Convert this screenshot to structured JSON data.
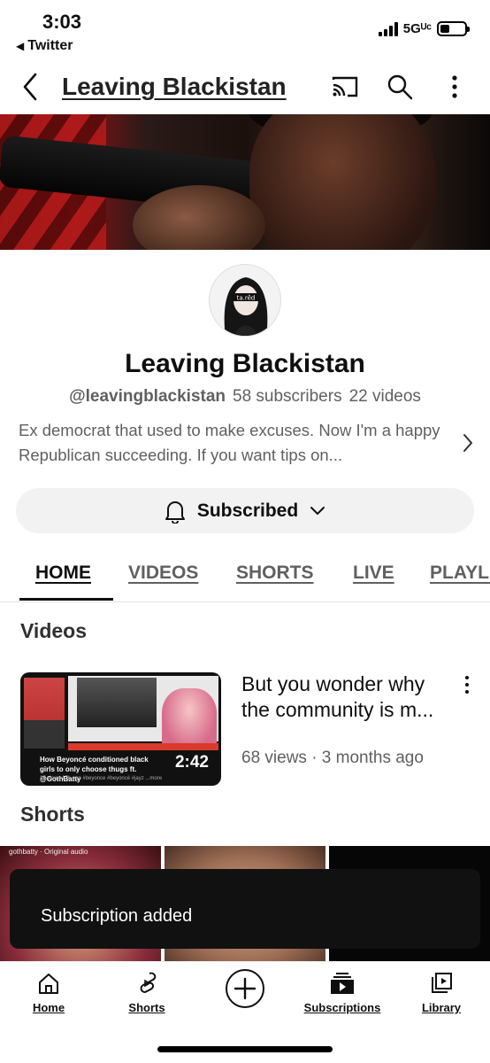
{
  "status_bar": {
    "time": "3:03",
    "back_app": "Twitter",
    "network": "5Gᵁᶜ"
  },
  "appbar": {
    "title": "Leaving Blackistan",
    "icons": [
      "back-arrow-icon",
      "cast-icon",
      "search-icon",
      "more-vertical-icon"
    ]
  },
  "channel": {
    "name": "Leaving Blackistan",
    "handle": "@leavingblackistan",
    "subscribers": "58 subscribers",
    "videos": "22 videos",
    "description": "Ex democrat that used to make excuses. Now I'm a happy Republican succeeding. If you want tips on...",
    "avatar_text": "ta.rêd"
  },
  "subscribe_button": {
    "label": "Subscribed"
  },
  "tabs": [
    {
      "label": "HOME",
      "active": true
    },
    {
      "label": "VIDEOS",
      "active": false
    },
    {
      "label": "SHORTS",
      "active": false
    },
    {
      "label": "LIVE",
      "active": false
    },
    {
      "label": "PLAYLISTS",
      "active": false
    }
  ],
  "videos_section": {
    "heading": "Videos",
    "items": [
      {
        "title": "But you wonder why the community is m...",
        "meta": "68 views · 3 months ago",
        "duration": "2:42",
        "thumb_caption": "How Beyoncé conditioned black girls to only choose thugs ft. @GothBatty",
        "thumb_subcaption": "15 views  17h ago  #beyonce  #beyoncé  #jayz  ...more"
      }
    ]
  },
  "shorts_section": {
    "heading": "Shorts",
    "first_tag": "gothbatty · Original audio"
  },
  "toast": {
    "message": "Subscription added"
  },
  "bottom_nav": [
    {
      "label": "Home",
      "icon": "home-icon"
    },
    {
      "label": "Shorts",
      "icon": "shorts-icon"
    },
    {
      "label": "",
      "icon": "create-plus-icon"
    },
    {
      "label": "Subscriptions",
      "icon": "subscriptions-icon"
    },
    {
      "label": "Library",
      "icon": "library-icon"
    }
  ]
}
